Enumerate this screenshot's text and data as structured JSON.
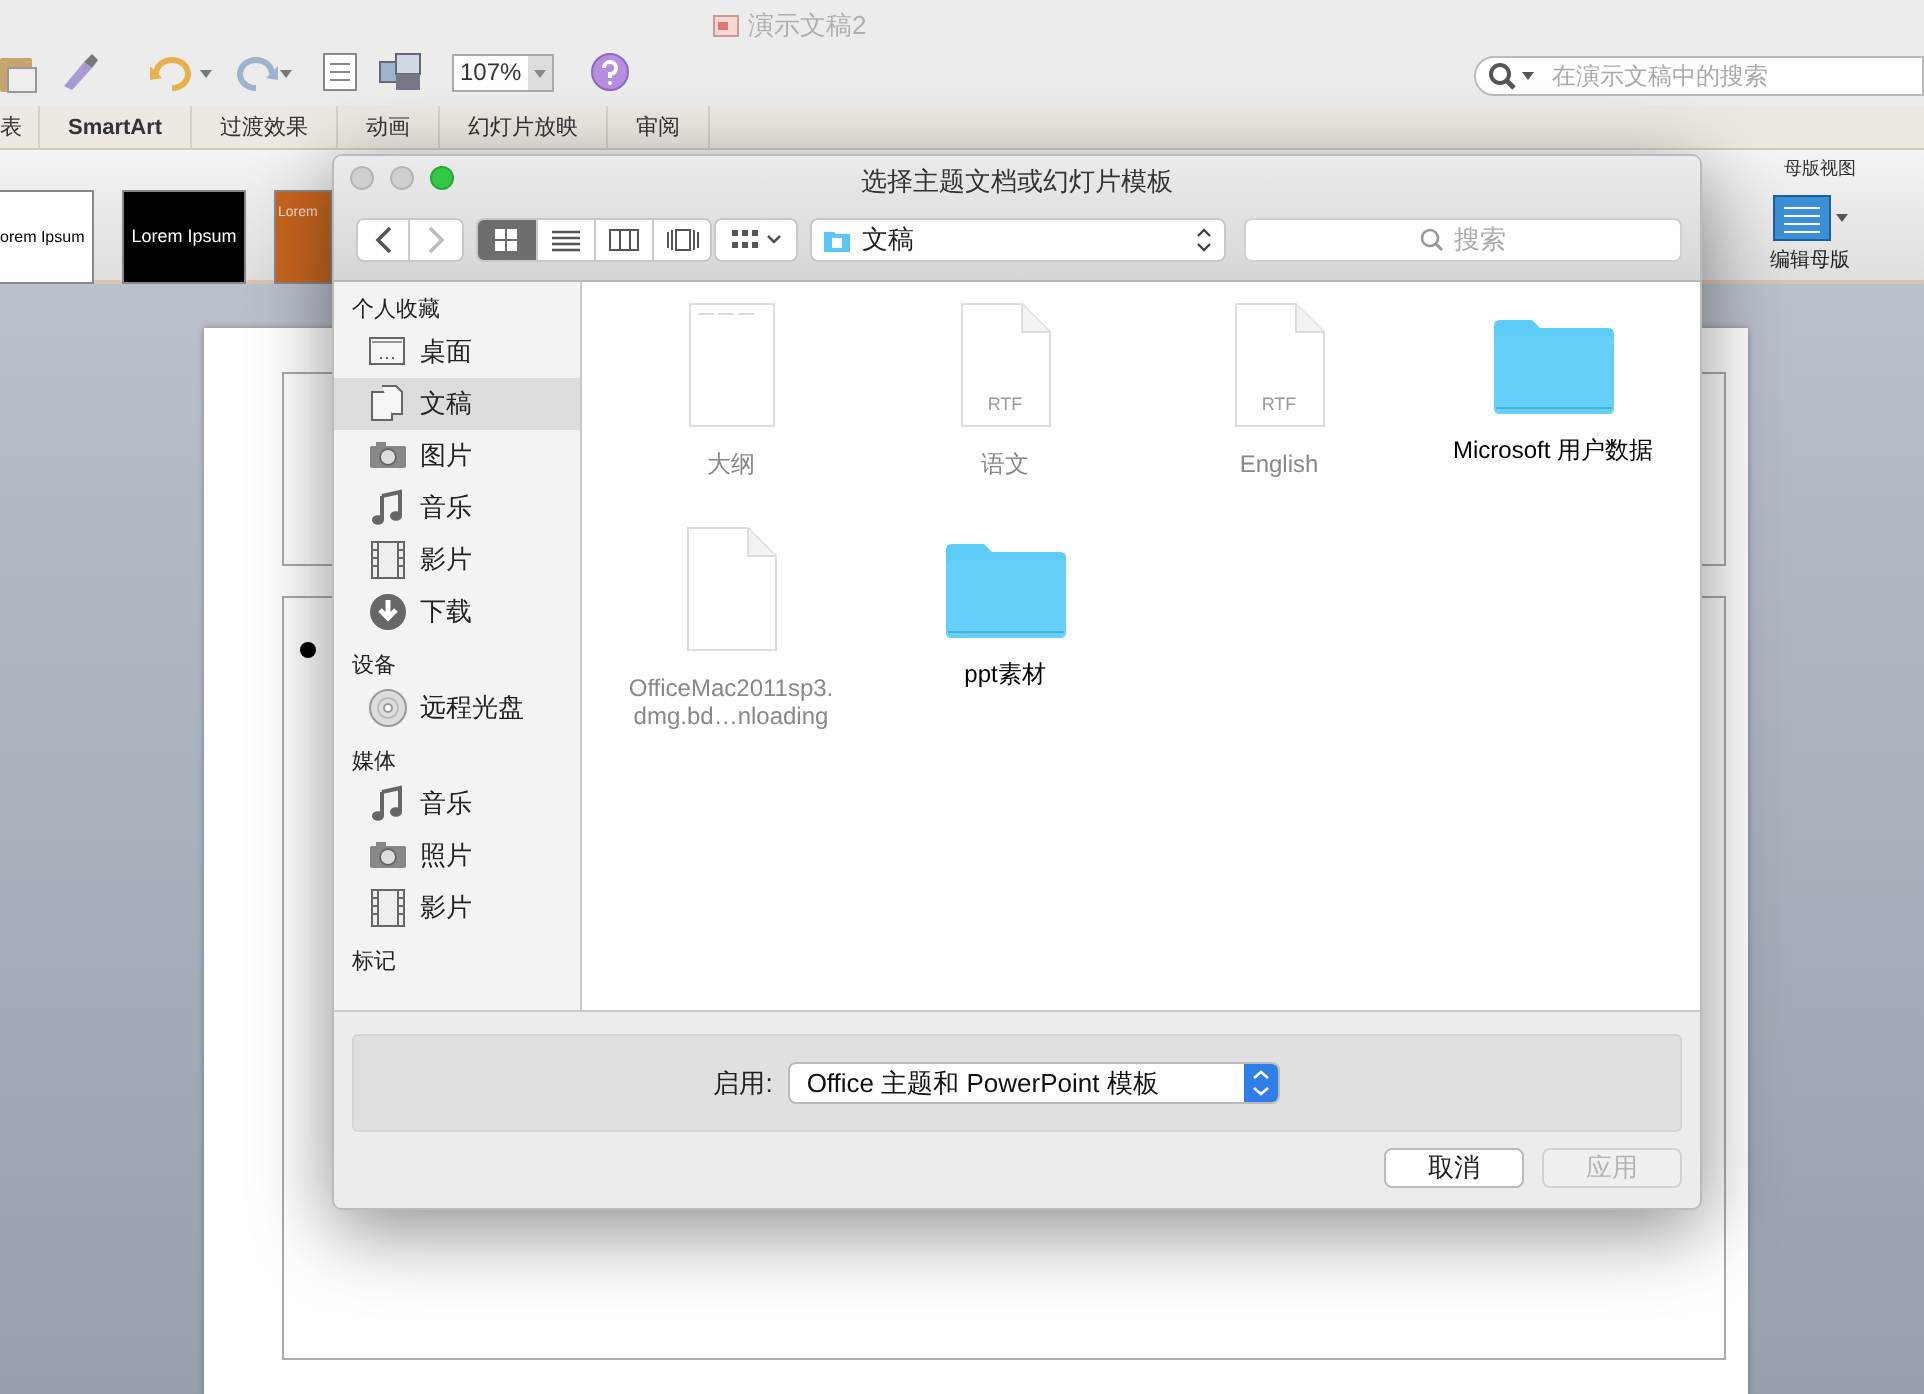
{
  "app": {
    "title": "演示文稿2",
    "zoom": "107%",
    "search_placeholder": "在演示文稿中的搜索",
    "ribbon_tabs": [
      {
        "label": "表",
        "bold": false
      },
      {
        "label": "SmartArt",
        "bold": true
      },
      {
        "label": "过渡效果",
        "bold": false
      },
      {
        "label": "动画",
        "bold": false
      },
      {
        "label": "幻灯片放映",
        "bold": false
      },
      {
        "label": "审阅",
        "bold": false
      }
    ],
    "theme_thumbnails": [
      {
        "label": "orem Ipsum",
        "kind": "white"
      },
      {
        "label": "Lorem Ipsum",
        "kind": "black"
      },
      {
        "label": "Lorem",
        "kind": "orange"
      }
    ],
    "master_view": {
      "group_label": "母版视图",
      "button_label": "编辑母版"
    }
  },
  "dialog": {
    "title": "选择主题文档或幻灯片模板",
    "location": "文稿",
    "search_placeholder": "搜索",
    "view_modes": [
      {
        "kind": "icons",
        "selected": true
      },
      {
        "kind": "list",
        "selected": false
      },
      {
        "kind": "columns",
        "selected": false
      },
      {
        "kind": "coverflow",
        "selected": false
      }
    ],
    "sidebar": [
      {
        "heading": "个人收藏",
        "items": [
          {
            "label": "桌面",
            "kind": "desktop",
            "selected": false
          },
          {
            "label": "文稿",
            "kind": "documents",
            "selected": true
          },
          {
            "label": "图片",
            "kind": "camera",
            "selected": false
          },
          {
            "label": "音乐",
            "kind": "music",
            "selected": false
          },
          {
            "label": "影片",
            "kind": "film",
            "selected": false
          },
          {
            "label": "下载",
            "kind": "download",
            "selected": false
          }
        ]
      },
      {
        "heading": "设备",
        "items": [
          {
            "label": "远程光盘",
            "kind": "disc",
            "selected": false
          }
        ]
      },
      {
        "heading": "媒体",
        "items": [
          {
            "label": "音乐",
            "kind": "music",
            "selected": false
          },
          {
            "label": "照片",
            "kind": "camera",
            "selected": false
          },
          {
            "label": "影片",
            "kind": "film",
            "selected": false
          }
        ]
      },
      {
        "heading": "标记"
      }
    ],
    "files": [
      {
        "label": "大纲",
        "kind": "outline",
        "disabled": true
      },
      {
        "label": "语文",
        "kind": "document",
        "badge": "RTF",
        "disabled": true
      },
      {
        "label": "English",
        "kind": "document",
        "badge": "RTF",
        "disabled": true
      },
      {
        "label": "Microsoft 用户数据",
        "kind": "folder",
        "disabled": false
      },
      {
        "label": "OfficeMac2011sp3.dmg.bd…nloading",
        "kind": "document",
        "disabled": true
      },
      {
        "label": "ppt素材",
        "kind": "folder",
        "disabled": false
      }
    ],
    "enable_label": "启用:",
    "enable_value": "Office 主题和 PowerPoint 模板",
    "buttons": [
      {
        "label": "取消",
        "disabled": false
      },
      {
        "label": "应用",
        "disabled": true
      }
    ]
  }
}
